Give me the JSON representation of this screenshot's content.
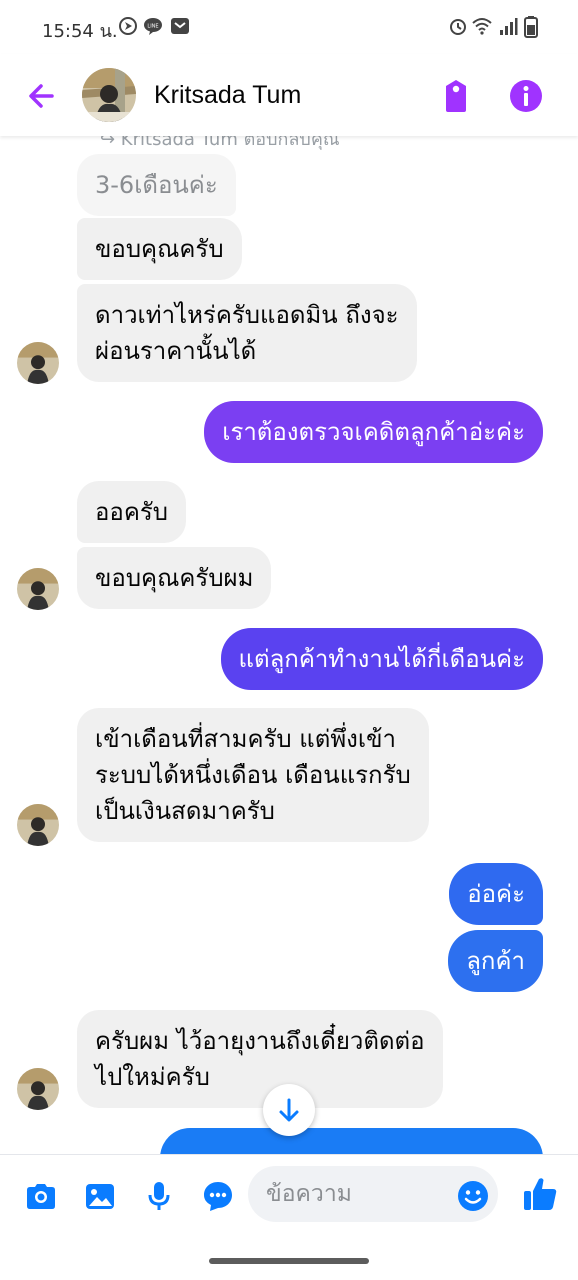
{
  "status_bar": {
    "time": "15:54 น.",
    "left_icons": [
      "navigation-icon",
      "line-icon",
      "notification-box-icon"
    ],
    "right_icons": [
      "alarm-icon",
      "wifi-icon",
      "signal-icon",
      "battery-icon"
    ]
  },
  "header": {
    "contact_name": "Kritsada Tum",
    "back_icon": "arrow-left-icon",
    "tag_icon": "tag-icon",
    "info_icon": "info-icon",
    "accent_color": "#a033ff"
  },
  "conversation": {
    "cut_text": "↪ Kritsada Tum ตอบกลับคุณ",
    "messages": [
      {
        "side": "in",
        "text": "3-6เดือนค่ะ",
        "style": "quoted"
      },
      {
        "side": "in",
        "text": "ขอบคุณครับ"
      },
      {
        "side": "in",
        "text": "ดาวเท่าไหร่ครับแอดมิน ถึงจะ\nผ่อนราคานั้นได้"
      },
      {
        "side": "out",
        "text": "เราต้องตรวจเคดิตลูกค้าอ่ะค่ะ",
        "color": "#7b3ff2"
      },
      {
        "side": "in",
        "text": "ออครับ"
      },
      {
        "side": "in",
        "text": "ขอบคุณครับผม"
      },
      {
        "side": "out",
        "text": "แต่ลูกค้าทำงานได้กี่เดือนค่ะ",
        "color": "#5a42f0"
      },
      {
        "side": "in",
        "text": "เข้าเดือนที่สามครับ แต่พึ่งเข้า\nระบบได้หนึ่งเดือน เดือนแรกรับ\nเป็นเงินสดมาครับ"
      },
      {
        "side": "out",
        "text": "อ่อค่ะ",
        "color": "#2f6af0"
      },
      {
        "side": "out",
        "text": "ลูกค้า",
        "color": "#2d70ef"
      },
      {
        "side": "in",
        "text": "ครับผม ไว้อายุงานถึงเดี๋ยวติดต่อ\nไปใหม่ครับ"
      }
    ],
    "partial_out_color": "#1a7cf5"
  },
  "composer": {
    "placeholder": "ข้อความ",
    "icons": [
      "camera-icon",
      "gallery-icon",
      "microphone-icon",
      "chat-bubble-icon"
    ],
    "emoji_icon": "emoji-icon",
    "like_icon": "thumbs-up-icon",
    "icon_color": "#0a7cff"
  }
}
